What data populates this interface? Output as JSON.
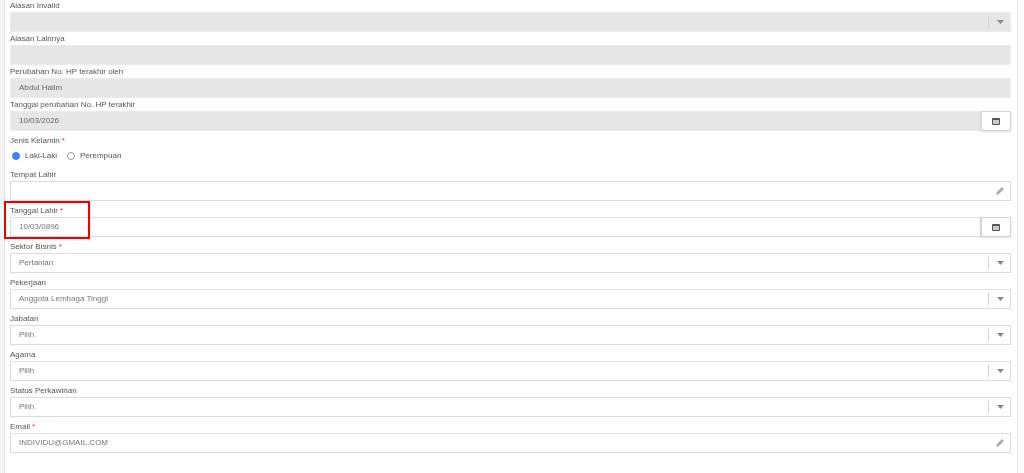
{
  "fields": [
    {
      "label": "Alasan Invalid",
      "kind": "select",
      "disabled": true
    },
    {
      "label": "Alasan Lainnya",
      "kind": "text",
      "disabled": true
    },
    {
      "label": "Perubahan No. HP terakhir oleh",
      "kind": "text",
      "value": "Abdul Halim",
      "disabled": true
    },
    {
      "label": "Tanggal perubahan No. HP terakhir",
      "kind": "date",
      "value": "10/03/2026",
      "disabled": true
    },
    {
      "label": "Jenis Kelamin",
      "required_mark": "*",
      "kind": "radio",
      "options": [
        {
          "label": "Laki-Laki",
          "selected": true
        },
        {
          "label": "Perempuan",
          "selected": false
        }
      ]
    },
    {
      "label": "Tempat Lahir",
      "kind": "edit",
      "disabled": false
    },
    {
      "label": "Tanggal Lahir",
      "required_mark": "*",
      "kind": "date",
      "value": "10/03/0896",
      "disabled": false,
      "highlighted": true
    },
    {
      "label": "Sektor Bisnis",
      "required_mark": "*",
      "kind": "select",
      "value": "Pertanian",
      "disabled": false
    },
    {
      "label": "Pekerjaan",
      "kind": "select",
      "value": "Anggota Lembaga Tinggi",
      "disabled": false
    },
    {
      "label": "Jabatan",
      "kind": "select",
      "value": "Pilih",
      "disabled": false
    },
    {
      "label": "Agama",
      "kind": "select",
      "value": "Pilih",
      "disabled": false
    },
    {
      "label": "Status Perkawinan",
      "kind": "select",
      "value": "Pilih",
      "disabled": false
    },
    {
      "label": "Email",
      "required_mark": "*",
      "kind": "edit",
      "value": "INDIVIDU@GMAIL.COM",
      "disabled": false
    }
  ]
}
